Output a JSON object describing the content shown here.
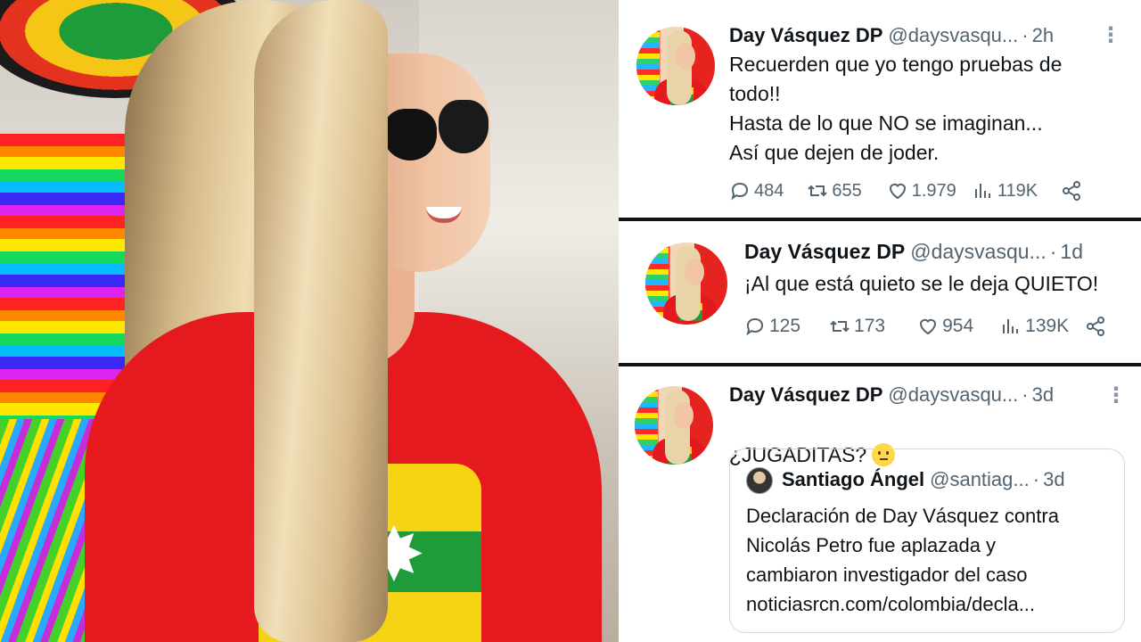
{
  "photo": {
    "alt_subject": "woman-in-sunglasses-red-shirt"
  },
  "tweets": [
    {
      "name": "Day Vásquez DP",
      "handle": "@daysvasqu...",
      "time": "2h",
      "text": "Recuerden que yo tengo pruebas de\ntodo!!\nHasta de lo que NO se imaginan...\nAsí que dejen de joder.",
      "replies": "484",
      "retweets": "655",
      "likes": "1.979",
      "views": "119K"
    },
    {
      "name": "Day Vásquez DP",
      "handle": "@daysvasqu...",
      "time": "1d",
      "text": "¡Al que está quieto se le deja QUIETO!",
      "replies": "125",
      "retweets": "173",
      "likes": "954",
      "views": "139K"
    },
    {
      "name": "Day Vásquez DP",
      "handle": "@daysvasqu...",
      "time": "3d",
      "text": "¿JUGADITAS?",
      "emoji": "thinking-face-emoji",
      "quote": {
        "name": "Santiago Ángel",
        "handle": "@santiag...",
        "time": "3d",
        "text": "Declaración de Day Vásquez contra\nNicolás Petro fue aplazada y\ncambiaron investigador del caso\n noticiasrcn.com/colombia/decla..."
      }
    }
  ],
  "ui": {
    "separator": "·",
    "more": "⋮"
  },
  "colors": {
    "text_primary": "#0f1419",
    "text_secondary": "#536471",
    "border": "#cfd9de",
    "divider": "#111111"
  },
  "icons": {
    "reply": "reply-icon",
    "retweet": "retweet-icon",
    "like": "heart-icon",
    "views": "views-icon",
    "share": "share-icon"
  }
}
